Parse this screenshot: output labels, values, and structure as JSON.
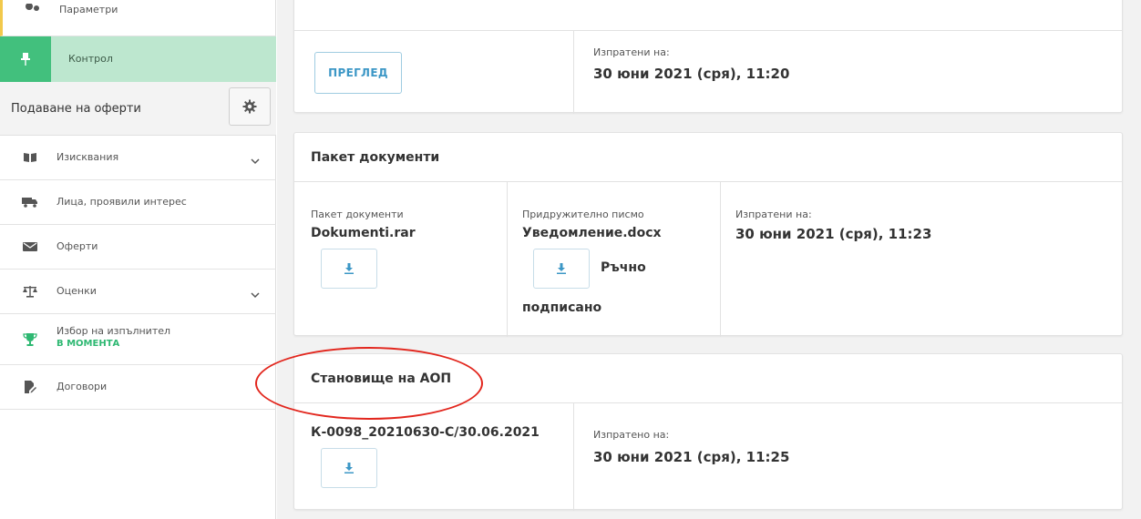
{
  "sidebar": {
    "items": [
      {
        "label": "Параметри",
        "icon": "gears-icon"
      },
      {
        "label": "Контрол",
        "icon": "pin-icon"
      },
      {
        "label": "Изисквания",
        "icon": "book-icon"
      },
      {
        "label": "Лица, проявили интерес",
        "icon": "truck-icon"
      },
      {
        "label": "Оферти",
        "icon": "envelope-icon"
      },
      {
        "label": "Оценки",
        "icon": "scales-icon"
      },
      {
        "label": "Избор на изпълнител",
        "sublabel": "В МОМЕНТА",
        "icon": "trophy-icon"
      },
      {
        "label": "Договори",
        "icon": "document-edit-icon"
      }
    ],
    "section_title": "Подаване на оферти"
  },
  "card1": {
    "button": "ПРЕГЛЕД",
    "sent_label": "Изпратени на:",
    "sent_value": "30 юни 2021 (сря), 11:20"
  },
  "card2": {
    "title": "Пакет документи",
    "col1_label": "Пакет документи",
    "col1_file": "Dokumenti.rar",
    "col2_label": "Придружително писмо",
    "col2_file": "Уведомление.docx",
    "col2_note_a": "Ръчно",
    "col2_note_b": "подписано",
    "col3_label": "Изпратени на:",
    "col3_value": "30 юни 2021 (сря), 11:23"
  },
  "card3": {
    "title": "Становище на АОП",
    "file": "К-0098_20210630-С/30.06.2021",
    "sent_label": "Изпратено на:",
    "sent_value": "30 юни 2021 (сря), 11:25"
  },
  "colors": {
    "accent_green": "#42c07d",
    "active_bg": "#bde7cf",
    "link_blue": "#3c97c6",
    "highlight_red": "#e2261d"
  }
}
